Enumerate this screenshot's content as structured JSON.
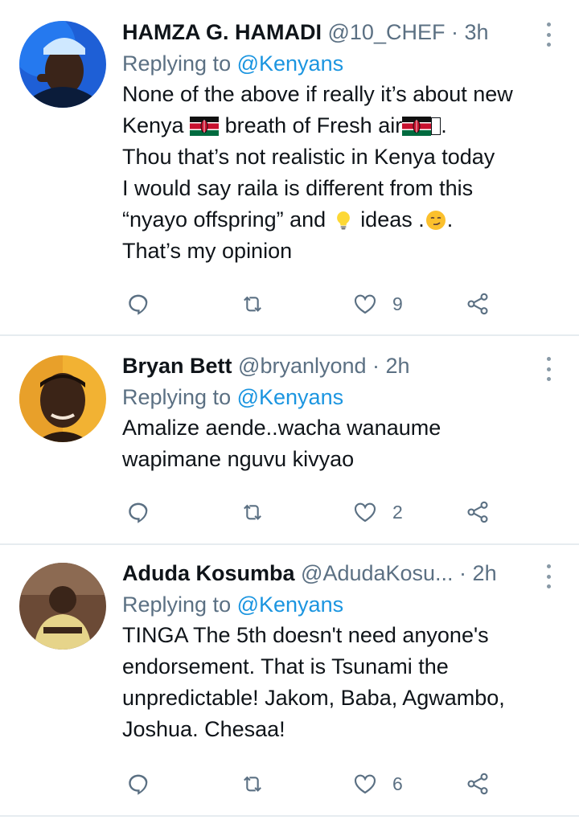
{
  "tweets": [
    {
      "name": "HAMZA G. HAMADI",
      "meta": "@10_CHEF · 3h",
      "reply_prefix": "Replying to",
      "reply_handle": "@Kenyans",
      "lines": [
        "None of the above if really it’s about new",
        "Kenya",
        "breath of Fresh air",
        ".",
        "Thou that’s not realistic in Kenya today",
        "I would say raila is different from this",
        "“nyayo offspring” and",
        "ideas .",
        ".",
        "That’s my opinion"
      ],
      "likes": "9"
    },
    {
      "name": "Bryan Bett",
      "meta": "@bryanlyond · 2h",
      "reply_prefix": "Replying to",
      "reply_handle": "@Kenyans",
      "lines": [
        "Amalize aende..wacha wanaume",
        "wapimane nguvu kivyao"
      ],
      "likes": "2"
    },
    {
      "name": "Aduda Kosumba",
      "meta": "@AdudaKosu...  · 2h",
      "reply_prefix": "Replying to",
      "reply_handle": "@Kenyans",
      "lines": [
        "TINGA The 5th doesn't need anyone's",
        "endorsement. That is Tsunami the",
        "unpredictable! Jakom, Baba, Agwambo,",
        "Joshua. Chesaa!"
      ],
      "likes": "6"
    }
  ],
  "icons": {
    "reply": "reply-icon",
    "retweet": "retweet-icon",
    "like": "heart-icon",
    "share": "share-icon",
    "more": "more-vertical-icon",
    "flag": "kenya-flag-icon",
    "bulb": "lightbulb-emoji-icon",
    "smirk": "smirking-face-emoji-icon"
  },
  "colors": {
    "text": "#0f1419",
    "muted": "#5b7083",
    "link": "#1b95e0",
    "divider": "#e6ecf0"
  }
}
